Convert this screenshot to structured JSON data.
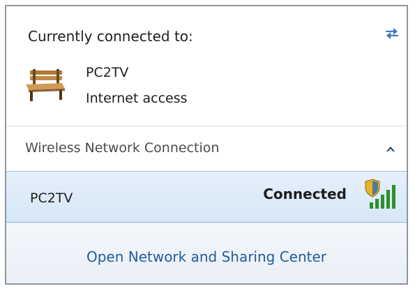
{
  "current_connection": {
    "title": "Currently connected to:",
    "network_name": "PC2TV",
    "access_status": "Internet access",
    "icons": {
      "refresh": "refresh-arrows-icon",
      "network": "park-bench-icon"
    }
  },
  "wireless_section": {
    "title": "Wireless Network Connection",
    "collapse_icon": "chevron-up-icon",
    "networks": [
      {
        "name": "PC2TV",
        "status": "Connected",
        "signal_icon": "wifi-signal-security-icon"
      }
    ]
  },
  "footer": {
    "link_label": "Open Network and Sharing Center"
  },
  "colors": {
    "link": "#1f5c9c",
    "selected_row": "#d6e7f7",
    "border": "#8f959c"
  }
}
